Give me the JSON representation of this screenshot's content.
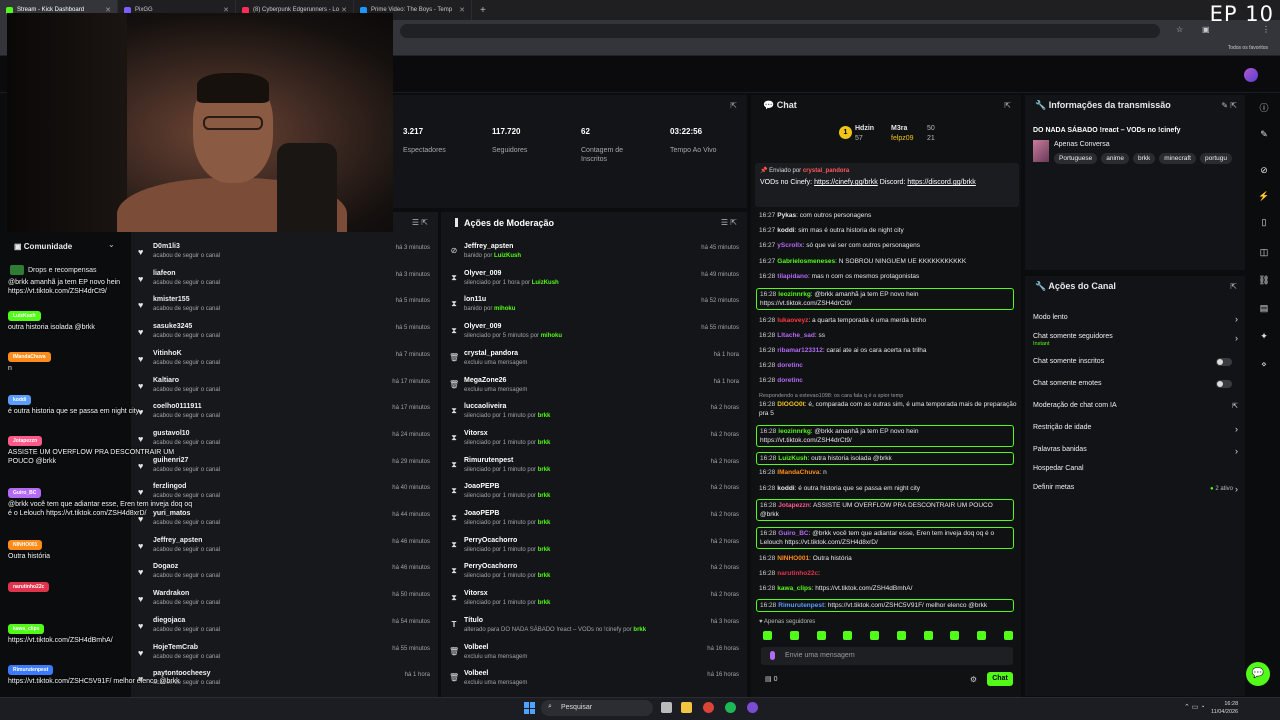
{
  "browser": {
    "tabs": [
      {
        "label": "Stream - Kick Dashboard",
        "active": true
      },
      {
        "label": "PixGG",
        "active": false
      },
      {
        "label": "(8) Cyberpunk Edgerunners - Lo",
        "active": false
      },
      {
        "label": "Prime Video: The Boys - Temp",
        "active": false
      }
    ],
    "new_tab": "+",
    "favorites_label": "Todos os favoritos"
  },
  "overlay": {
    "episode": "EP 10"
  },
  "stats": [
    {
      "value": "3.217",
      "label": "Espectadores"
    },
    {
      "value": "117.720",
      "label": "Seguidores"
    },
    {
      "value": "62",
      "label": "Contagem de Inscritos"
    },
    {
      "value": "03:22:56",
      "label": "Tempo Ao Vivo"
    }
  ],
  "community": {
    "title": "Comunidade",
    "drops": "Drops e recompensas"
  },
  "overlay_chat": [
    {
      "user": "",
      "msg": "@brkk amanhã ja tem EP novo hein https://vt.tiktok.com/ZSH4drCt9/",
      "color": ""
    },
    {
      "user": "LuizKush",
      "msg": "outra historia isolada @brkk",
      "color": "#53fc18"
    },
    {
      "user": "IMandaChuva",
      "msg": "n",
      "color": "#ff8c1a"
    },
    {
      "user": "koddi",
      "msg": "é outra historia que se passa em night city",
      "color": "#5b9dff"
    },
    {
      "user": "Jotapezzn",
      "msg": "ASSISTE UM OVERFLOW PRA DESCONTRAIR UM POUCO @brkk",
      "color": "#ff5a8a"
    },
    {
      "user": "Guiro_BC",
      "msg": "@brkk você tem que adiantar esse, Eren tem inveja doq oq é o Lelouch https://vt.tiktok.com/ZSH4d8xrD/",
      "color": "#b36af5"
    },
    {
      "user": "NINHO001",
      "msg": "Outra história",
      "color": "#ff8c1a"
    },
    {
      "user": "narutinho22c",
      "msg": "",
      "color": "#e0344d"
    },
    {
      "user": "kawa_clips",
      "msg": "https://vt.tiktok.com/ZSH4dBmhA/",
      "color": "#53fc18"
    },
    {
      "user": "Rimurutenpest",
      "msg": "https://vt.tiktok.com/ZSHC5V91F/ melhor elenco @brkk",
      "color": "#3a7bff"
    }
  ],
  "followers": {
    "sub_label": "acabou de seguir o canal",
    "rows": [
      {
        "name": "D0m1li3",
        "time": "há 3 minutos"
      },
      {
        "name": "liafeon",
        "time": "há 3 minutos"
      },
      {
        "name": "kmister155",
        "time": "há 5 minutos"
      },
      {
        "name": "sasuke3245",
        "time": "há 5 minutos"
      },
      {
        "name": "VitinhoK",
        "time": "há 7 minutos"
      },
      {
        "name": "Kaltiaro",
        "time": "há 17 minutos"
      },
      {
        "name": "coelho0111911",
        "time": "há 17 minutos"
      },
      {
        "name": "gustavol10",
        "time": "há 24 minutos"
      },
      {
        "name": "guihenri27",
        "time": "há 29 minutos"
      },
      {
        "name": "ferzlingod",
        "time": "há 40 minutos"
      },
      {
        "name": "yuri_matos",
        "time": "há 44 minutos"
      },
      {
        "name": "Jeffrey_apsten",
        "time": "há 46 minutos"
      },
      {
        "name": "Dogaoz",
        "time": "há 46 minutos"
      },
      {
        "name": "Wardrakon",
        "time": "há 50 minutos"
      },
      {
        "name": "diegojaca",
        "time": "há 54 minutos"
      },
      {
        "name": "HojeTemCrab",
        "time": "há 55 minutos"
      },
      {
        "name": "paytontoocheesy",
        "time": "há 1 hora"
      }
    ]
  },
  "moderation": {
    "title": "Ações de Moderação",
    "rows": [
      {
        "icon": "ban",
        "name": "Jeffrey_apsten",
        "pre": "banido por ",
        "by": "LuizKush",
        "time": "há 45 minutos"
      },
      {
        "icon": "timeout",
        "name": "Olyver_009",
        "pre": "silenciado por 1 hora por ",
        "by": "LuizKush",
        "time": "há 49 minutos"
      },
      {
        "icon": "timeout",
        "name": "lon11u",
        "pre": "banido por ",
        "by": "mihoku",
        "time": "há 52 minutos"
      },
      {
        "icon": "timeout",
        "name": "Olyver_009",
        "pre": "silenciado por 5 minutos por ",
        "by": "mihoku",
        "time": "há 55 minutos"
      },
      {
        "icon": "delete",
        "name": "crystal_pandora",
        "pre": "excluiu uma mensagem",
        "by": "",
        "time": "há 1 hora"
      },
      {
        "icon": "delete",
        "name": "MegaZone26",
        "pre": "excluiu uma mensagem",
        "by": "",
        "time": "há 1 hora"
      },
      {
        "icon": "timeout",
        "name": "luccaoliveira",
        "pre": "silenciado por 1 minuto por ",
        "by": "brkk",
        "time": "há 2 horas"
      },
      {
        "icon": "timeout",
        "name": "Vitorsx",
        "pre": "silenciado por 1 minuto por ",
        "by": "brkk",
        "time": "há 2 horas"
      },
      {
        "icon": "timeout",
        "name": "Rimurutenpest",
        "pre": "silenciado por 1 minuto por ",
        "by": "brkk",
        "time": "há 2 horas"
      },
      {
        "icon": "timeout",
        "name": "JoaoPEPB",
        "pre": "silenciado por 1 minuto por ",
        "by": "brkk",
        "time": "há 2 horas"
      },
      {
        "icon": "timeout",
        "name": "JoaoPEPB",
        "pre": "silenciado por 1 minuto por ",
        "by": "brkk",
        "time": "há 2 horas"
      },
      {
        "icon": "timeout",
        "name": "PerryOcachorro",
        "pre": "silenciado por 1 minuto por ",
        "by": "brkk",
        "time": "há 2 horas"
      },
      {
        "icon": "timeout",
        "name": "PerryOcachorro",
        "pre": "silenciado por 1 minuto por ",
        "by": "brkk",
        "time": "há 2 horas"
      },
      {
        "icon": "timeout",
        "name": "Vitorsx",
        "pre": "silenciado por 1 minuto por ",
        "by": "brkk",
        "time": "há 2 horas"
      },
      {
        "icon": "title",
        "name": "Título",
        "pre": "alterado para DO NADA SÁBADO !react – VODs no !cinefy por ",
        "by": "brkk",
        "time": "há 3 horas"
      },
      {
        "icon": "delete",
        "name": "Volbeel",
        "pre": "excluiu uma mensagem",
        "by": "",
        "time": "há 16 horas"
      },
      {
        "icon": "delete",
        "name": "Volbeel",
        "pre": "excluiu uma mensagem",
        "by": "",
        "time": "há 16 horas"
      }
    ]
  },
  "chat": {
    "title": "Chat",
    "leaderboard": {
      "first": "Hdzin",
      "first_score": "57",
      "second": "M3ra",
      "second_score": "50",
      "third": "felpz09",
      "third_score": "21"
    },
    "pinned": {
      "header": "Enviado por",
      "user": "crystal_pandora",
      "text": "VODs no Cinefy: ",
      "link1": "https://cinefy.gg/brkk",
      "mid": " Discord: ",
      "link2": "https://discord.gg/brkk"
    },
    "messages": [
      {
        "time": "16:27",
        "user": "Pykas",
        "color": "#e8e8e8",
        "text": ": com outros personagens",
        "hl": false
      },
      {
        "time": "16:27",
        "user": "koddi",
        "color": "#e8e8e8",
        "text": ": sim mas é outra historia de night city",
        "hl": false
      },
      {
        "time": "16:27",
        "user": "yScrollx",
        "color": "#b36af5",
        "text": ": só que vai ser com outros personagens",
        "hl": false
      },
      {
        "time": "16:27",
        "user": "Gabrielosmeneses",
        "color": "#53fc18",
        "text": ": N SOBROU NINGUEM UE KKKKKKKKKKK",
        "hl": false
      },
      {
        "time": "16:28",
        "user": "tilapidano",
        "color": "#b36af5",
        "text": ": mas n com os mesmos protagonistas",
        "hl": false
      },
      {
        "time": "16:28",
        "user": "leozinnrkg",
        "color": "#53fc18",
        "text": ": @brkk amanhã ja tem EP novo hein https://vt.tiktok.com/ZSH4drCt9/",
        "hl": true
      },
      {
        "time": "16:28",
        "user": "lukaoveyz",
        "color": "#ff3b3b",
        "text": ": a quarta temporada é uma merda bicho",
        "hl": false
      },
      {
        "time": "16:28",
        "user": "Lltache_sad",
        "color": "#b36af5",
        "text": ": ss",
        "hl": false
      },
      {
        "time": "16:28",
        "user": "ribamar123312",
        "color": "#b36af5",
        "text": ": caraí ate ai os cara acerta na trilha",
        "hl": false
      },
      {
        "time": "16:28",
        "user": "doretinc",
        "color": "#b36af5",
        "text": "",
        "hl": false
      },
      {
        "time": "16:28",
        "user": "doretinc",
        "color": "#b36af5",
        "text": "",
        "hl": false
      },
      {
        "time": "16:28",
        "user": "DIOGO0t",
        "color": "#f0c419",
        "text": ": é, comparada com as outras sim, é uma temporada mais de preparação pra 5",
        "hl": false
      },
      {
        "time": "16:28",
        "user": "leozinnrkg",
        "color": "#53fc18",
        "text": ": @brkk amanhã ja tem EP novo hein https://vt.tiktok.com/ZSH4drCt9/",
        "hl": true
      },
      {
        "time": "16:28",
        "user": "LuizKush",
        "color": "#53fc18",
        "text": ": outra historia isolada @brkk",
        "hl": true
      },
      {
        "time": "16:28",
        "user": "IMandaChuva",
        "color": "#ff8c1a",
        "text": ": n",
        "hl": false
      },
      {
        "time": "16:28",
        "user": "koddi",
        "color": "#e8e8e8",
        "text": ": é outra historia que se passa em night city",
        "hl": false
      },
      {
        "time": "16:28",
        "user": "Jotapezzn",
        "color": "#ff5a8a",
        "text": ": ASSISTE UM OVERFLOW PRA DESCONTRAIR UM POUCO @brkk",
        "hl": true
      },
      {
        "time": "16:28",
        "user": "Guiro_BC",
        "color": "#b36af5",
        "text": ": @brkk você tem que adiantar esse, Eren tem inveja doq oq é o Lelouch https://vt.tiktok.com/ZSH4d8xrD/",
        "hl": true
      },
      {
        "time": "16:28",
        "user": "NINHO001",
        "color": "#ff8c1a",
        "text": ": Outra história",
        "hl": false
      },
      {
        "time": "16:28",
        "user": "narutinho22c",
        "color": "#e0344d",
        "text": ":",
        "hl": false
      },
      {
        "time": "16:28",
        "user": "kawa_clips",
        "color": "#53fc18",
        "text": ": https://vt.tiktok.com/ZSH4dBmhA/",
        "hl": false
      },
      {
        "time": "16:28",
        "user": "Rimurutenpest",
        "color": "#5b9dff",
        "text": ": https://vt.tiktok.com/ZSHC5V91F/ melhor elenco @brkk",
        "hl": true
      }
    ],
    "reply_note": "Respondendo a estevao1098: os cara fala q é a spior temp",
    "only_followers": "Apenas seguidores",
    "input_placeholder": "Envie uma mensagem",
    "count": "0",
    "send": "Chat"
  },
  "info": {
    "title": "Informações da transmissão",
    "stream_title": "DO NADA SÁBADO !react – VODs no !cinefy",
    "category": "Apenas Conversa",
    "tags": [
      "Portuguese",
      "anime",
      "brkk",
      "minecraft",
      "portugu"
    ]
  },
  "actions": {
    "title": "Ações do Canal",
    "items": [
      {
        "label": "Modo lento",
        "control": "arrow",
        "sub": ""
      },
      {
        "label": "Chat somente seguidores",
        "control": "arrow",
        "sub": "Instant"
      },
      {
        "label": "Chat somente inscritos",
        "control": "toggle",
        "sub": ""
      },
      {
        "label": "Chat somente emotes",
        "control": "toggle",
        "sub": ""
      },
      {
        "label": "Moderação de chat com IA",
        "control": "external",
        "sub": ""
      },
      {
        "label": "Restrição de idade",
        "control": "arrow",
        "sub": ""
      },
      {
        "label": "Palavras banidas",
        "control": "arrow",
        "sub": ""
      },
      {
        "label": "Hospedar Canal",
        "control": "none",
        "sub": ""
      },
      {
        "label": "Definir metas",
        "control": "arrow",
        "sub": ""
      }
    ],
    "goals_active": "2 ativo"
  },
  "taskbar": {
    "search": "Pesquisar",
    "time": "16:28",
    "date": "11/04/2026"
  }
}
